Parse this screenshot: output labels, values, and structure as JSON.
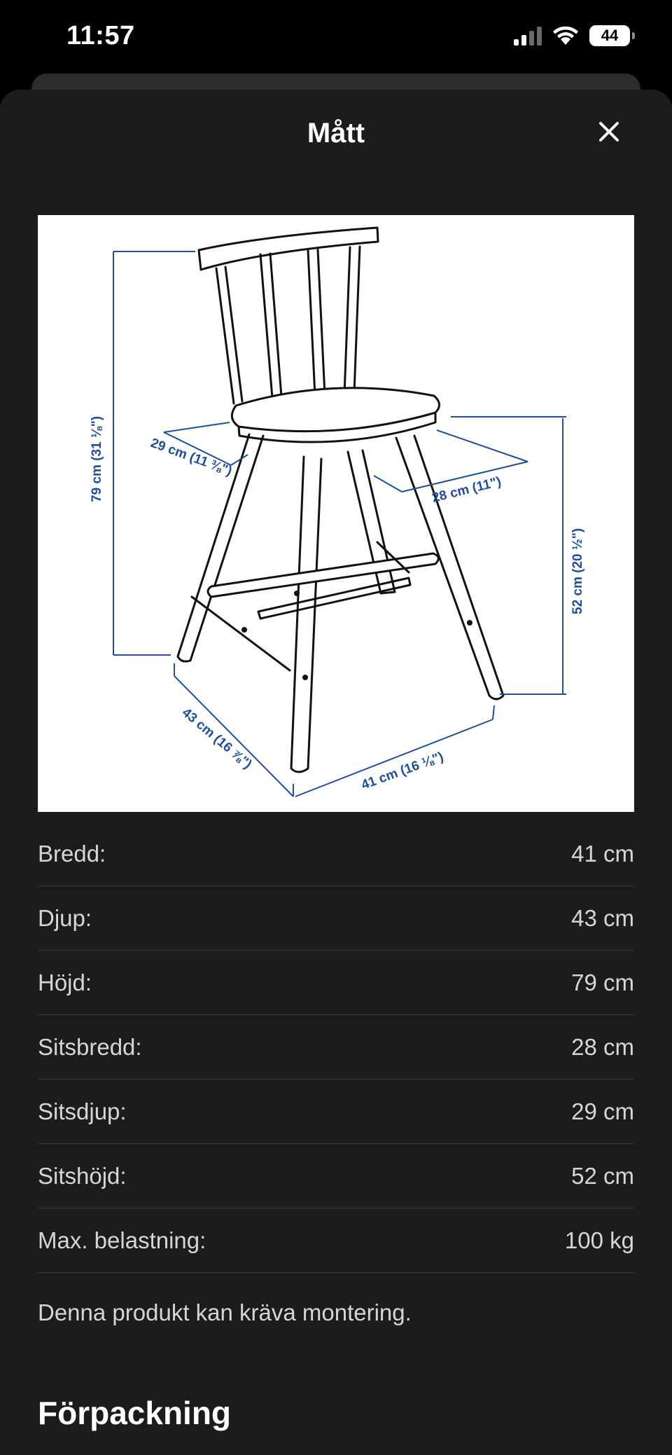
{
  "status_bar": {
    "time": "11:57",
    "battery": "44",
    "icons": [
      "signal-icon",
      "wifi-icon",
      "battery-icon"
    ]
  },
  "sheet": {
    "title": "Mått",
    "close_icon": "close-icon"
  },
  "diagram": {
    "labels": {
      "height": "79 cm (31 ⅛\")",
      "seat_depth": "29 cm (11 ⅜\")",
      "seat_width": "28 cm (11\")",
      "seat_height": "52 cm (20 ½\")",
      "depth": "43 cm (16 ⅞\")",
      "width": "41 cm (16 ⅛\")"
    },
    "dimension_color": "#1f4e9c",
    "line_color": "#111111"
  },
  "measurements": [
    {
      "label": "Bredd:",
      "value": "41 cm"
    },
    {
      "label": "Djup:",
      "value": "43 cm"
    },
    {
      "label": "Höjd:",
      "value": "79 cm"
    },
    {
      "label": "Sitsbredd:",
      "value": "28 cm"
    },
    {
      "label": "Sitsdjup:",
      "value": "29 cm"
    },
    {
      "label": "Sitshöjd:",
      "value": "52 cm"
    },
    {
      "label": "Max. belastning:",
      "value": "100 kg"
    }
  ],
  "note": "Denna produkt kan kräva montering.",
  "section_title": "Förpackning"
}
